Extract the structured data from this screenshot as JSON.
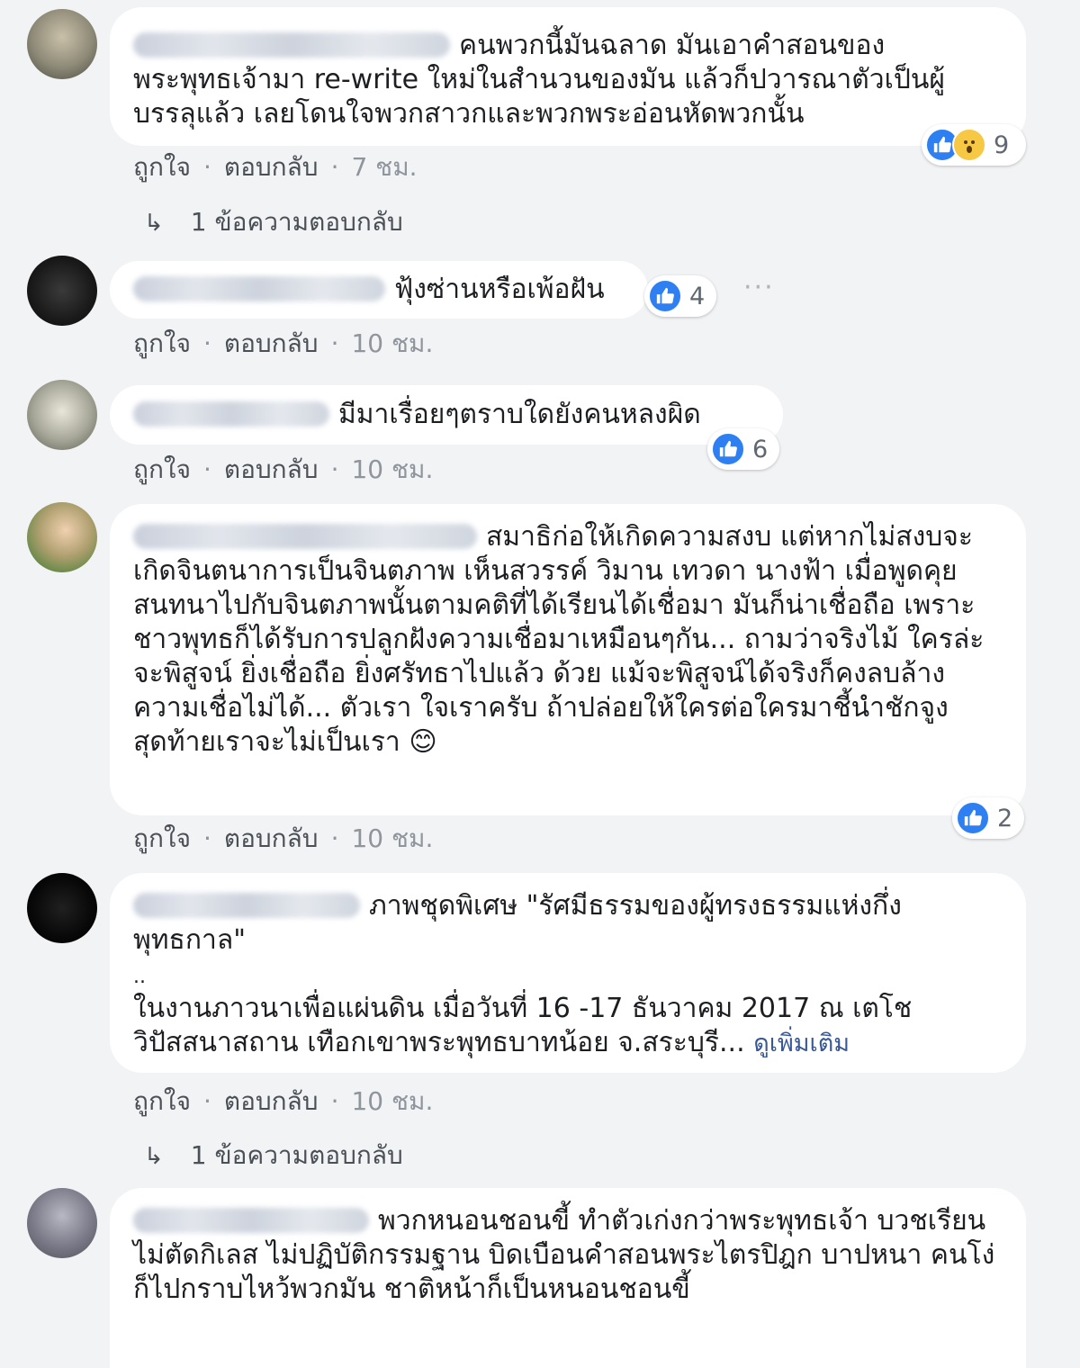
{
  "meta_labels": {
    "like": "ถูกใจ",
    "reply": "ตอบกลับ",
    "separator": "·"
  },
  "comments": [
    {
      "text": "คนพวกนี้มันฉลาด มันเอาคำสอนของพระพุทธเจ้ามา re-write ใหม่ในสำนวนของมัน แล้วก็ปวารณาตัวเป็นผู้บรรลุแล้ว เลยโดนใจพวกสาวกและพวกพระอ่อนหัดพวกนั้น",
      "time": "7 ชม.",
      "reaction_count": "9",
      "replies_label": "1 ข้อความตอบกลับ"
    },
    {
      "text": "ฟุ้งซ่านหรือเพ้อฝัน",
      "time": "10 ชม.",
      "reaction_count": "4"
    },
    {
      "text": "มีมาเรื่อยๆตราบใดยังคนหลงผิด",
      "time": "10 ชม.",
      "reaction_count": "6"
    },
    {
      "text": "สมาธิก่อให้เกิดความสงบ แต่หากไม่สงบจะเกิดจินตนาการเป็นจินตภาพ เห็นสวรรค์ วิมาน เทวดา นางฟ้า เมื่อพูดคุยสนทนาไปกับจินตภาพนั้นตามคติที่ได้เรียนได้เชื่อมา มันก็น่าเชื่อถือ เพราะชาวพุทธก็ได้รับการปลูกฝังความเชื่อมาเหมือนๆกัน... ถามว่าจริงไม้ ใครล่ะจะพิสูจน์ ยิ่งเชื่อถือ ยิ่งศรัทธาไปแล้ว ด้วย แม้จะพิสูจน์ได้จริงก็คงลบล้างความเชื่อไม่ได้... ตัวเรา ใจเราครับ ถ้าปล่อยให้ใครต่อใครมาชี้นำชักจูง สุดท้ายเราจะไม่เป็นเรา",
      "emoji": "😊",
      "time": "10 ชม.",
      "reaction_count": "2"
    },
    {
      "text_line1": "ภาพชุดพิเศษ \"รัศมีธรรมของผู้ทรงธรรมแห่งกึ่งพุทธกาล\"",
      "text_dots": "..",
      "text_line2": "ในงานภาวนาเพื่อแผ่นดิน เมื่อวันที่ 16 -17 ธันวาคม 2017 ณ เตโชวิปัสสนาสถาน เทือกเขาพระพุทธบาทน้อย จ.สระบุรี...",
      "see_more": "ดูเพิ่มเติม",
      "time": "10 ชม.",
      "replies_label": "1 ข้อความตอบกลับ"
    },
    {
      "text": "พวกหนอนชอนขี้ ทำตัวเก่งกว่าพระพุทธเจ้า บวชเรียนไม่ตัดกิเลส ไม่ปฏิบัติกรรมฐาน บิดเบือนคำสอนพระไตรปิฎก บาปหนา คนโง่ก็ไปกราบไหว้พวกมัน ชาติหน้าก็เป็นหนอนชอนขี้"
    }
  ],
  "colors": {
    "background": "#f2f3f5",
    "bubble": "#ffffff",
    "like_blue": "#2d7ff2",
    "wow_yellow": "#f7c844",
    "meta_gray": "#606770"
  },
  "icons": [
    "like-icon",
    "wow-icon",
    "reply-arrow-icon",
    "more-options-icon",
    "smile-emoji"
  ]
}
